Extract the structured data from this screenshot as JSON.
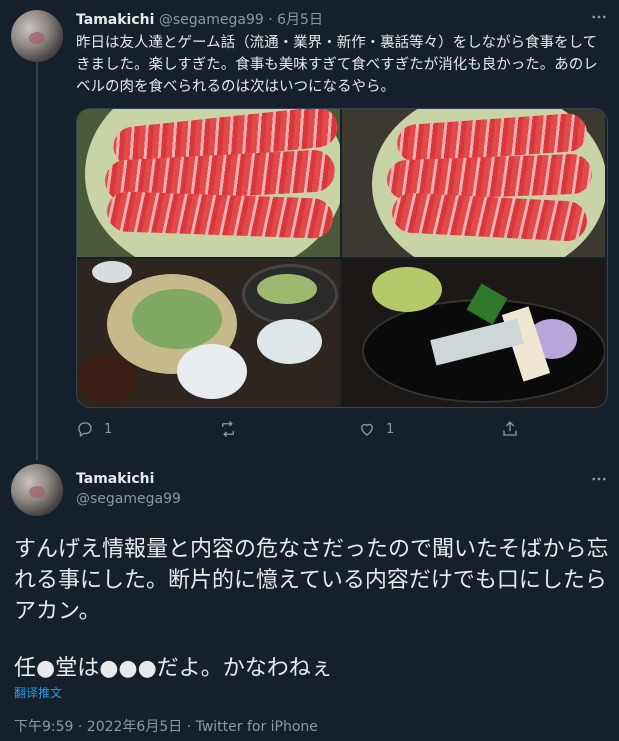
{
  "tweet1": {
    "name": "Tamakichi",
    "handle": "@segamega99",
    "separator": "·",
    "date": "6月5日",
    "text": "昨日は友人達とゲーム話（流通・業界・新作・裏話等々）をしながら食事をしてきました。楽しすぎた。食事も美味すぎて食べすぎたが消化も良かった。あのレベルの肉を食べられるのは次はいつになるやら。",
    "reply_count": "1",
    "retweet_count": "",
    "like_count": "1"
  },
  "tweet2": {
    "name": "Tamakichi",
    "handle": "@segamega99",
    "text": "すんげえ情報量と内容の危なさだったので聞いたそばから忘れる事にした。断片的に憶えている内容だけでも口にしたらアカン。",
    "text2": "任●堂は●●●だよ。かなわねぇ",
    "translate": "翻译推文",
    "time": "下午9:59 · 2022年6月5日 · Twitter for iPhone"
  },
  "icons": {
    "more": "more-icon",
    "reply": "reply-icon",
    "retweet": "retweet-icon",
    "like": "heart-icon",
    "share": "share-icon"
  },
  "colors": {
    "background": "#15202b",
    "text": "#e7e9ea",
    "muted": "#8b98a5",
    "link": "#1d9bf0"
  }
}
